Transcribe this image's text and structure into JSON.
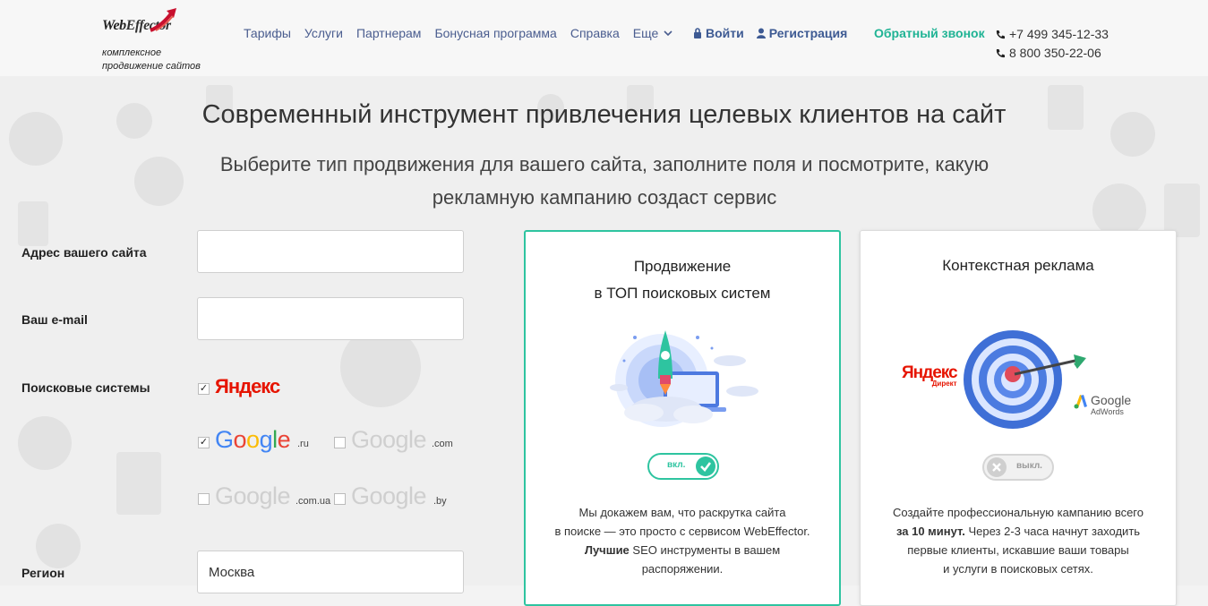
{
  "header": {
    "logo_word_1": "Web",
    "logo_word_2": "Effector",
    "logo_tagline_1": "комплексное",
    "logo_tagline_2": "продвижение сайтов",
    "nav": [
      "Тарифы",
      "Услуги",
      "Партнерам",
      "Бонусная программа",
      "Справка",
      "Еще"
    ],
    "login_label": "Войти",
    "register_label": "Регистрация",
    "callback_label": "Обратный звонок",
    "phone_1": "+7 499 345-12-33",
    "phone_2": "8 800 350-22-06"
  },
  "hero": {
    "title": "Современный инструмент привлечения целевых клиентов на сайт",
    "subtitle_1": "Выберите тип продвижения для вашего сайта, заполните поля и посмотрите, какую",
    "subtitle_2": "рекламную кампанию создаст сервис"
  },
  "form": {
    "site_label": "Адрес вашего сайта",
    "site_value": "",
    "email_label": "Ваш e-mail",
    "email_value": "",
    "engines_label": "Поисковые системы",
    "yandex_word": "Яндекс",
    "google_word": "Google",
    "engines": [
      {
        "domain": "",
        "checked": true
      },
      {
        "domain": ".ru",
        "checked": true
      },
      {
        "domain": ".com",
        "checked": false
      },
      {
        "domain": ".com.ua",
        "checked": false
      },
      {
        "domain": ".by",
        "checked": false
      }
    ],
    "region_label": "Регион",
    "region_value": "Москва"
  },
  "cards": {
    "seo": {
      "title_1": "Продвижение",
      "title_2": "в ТОП поисковых систем",
      "toggle_label": "вкл.",
      "desc_1": "Мы докажем вам, что раскрутка сайта",
      "desc_2": "в поиске — это просто с сервисом WebEffector.",
      "desc_3_bold": "Лучшие",
      "desc_3_rest": " SEO инструменты в вашем",
      "desc_4": "распоряжении."
    },
    "context": {
      "title": "Контекстная реклама",
      "yandex_word": "Яндекс",
      "yandex_sub": "Директ",
      "google_word": "Google",
      "google_sub": "AdWords",
      "toggle_label": "выкл.",
      "desc_1": "Создайте профессиональную кампанию всего",
      "desc_2_bold": "за 10 минут.",
      "desc_2_rest": " Через 2-3 часа начнут заходить",
      "desc_3": "первые клиенты, искавшие ваши товары",
      "desc_4": "и услуги в поисковых сетях."
    }
  },
  "colors": {
    "accent_green": "#2ec4a0",
    "nav_blue": "#4a5d8f",
    "callback_green": "#1fb394"
  }
}
